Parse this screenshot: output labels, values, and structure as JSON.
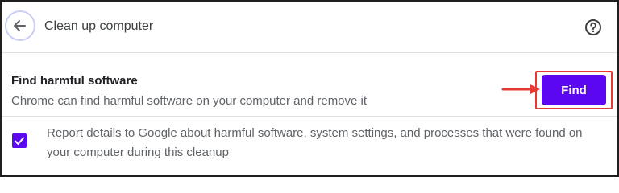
{
  "header": {
    "title": "Clean up computer",
    "back_icon": "arrow-left-icon",
    "help_icon": "help-circle-icon"
  },
  "section": {
    "title": "Find harmful software",
    "description": "Chrome can find harmful software on your computer and remove it",
    "find_label": "Find"
  },
  "report": {
    "checked": true,
    "text": "Report details to Google about harmful software, system settings, and processes that were found on your computer during this cleanup"
  },
  "colors": {
    "accent": "#5b08f0",
    "highlight": "#e53935"
  }
}
